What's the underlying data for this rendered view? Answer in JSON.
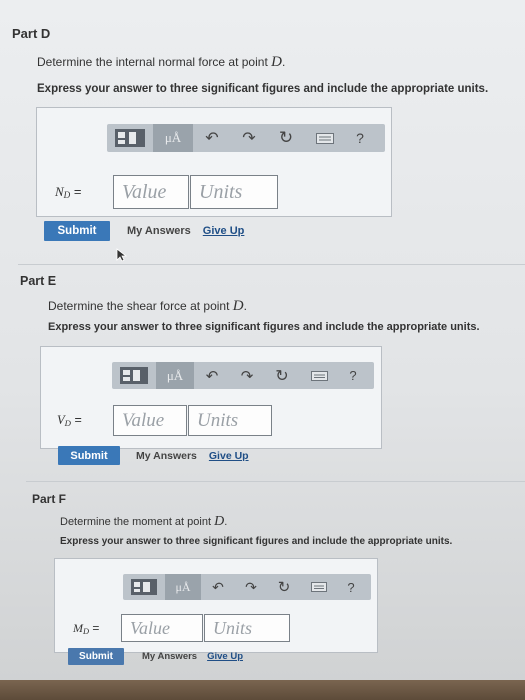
{
  "toolbar": {
    "mu_label": "μÅ",
    "undo_icon": "undo-arrow",
    "redo_icon": "redo-arrow",
    "reset_icon": "reset",
    "keyboard_icon": "keyboard",
    "help_label": "?"
  },
  "parts": [
    {
      "title": "Part D",
      "question_prefix": "Determine the internal normal force at point ",
      "question_var": "D",
      "question_suffix": ".",
      "instruction": "Express your answer to three significant figures and include the appropriate units.",
      "var_main": "N",
      "var_sub": "D",
      "equals": " =",
      "value_placeholder": "Value",
      "units_placeholder": "Units",
      "submit_label": "Submit",
      "my_answers_label": "My Answers",
      "give_up_label": "Give Up"
    },
    {
      "title": "Part E",
      "question_prefix": "Determine the shear force at point ",
      "question_var": "D",
      "question_suffix": ".",
      "instruction": "Express your answer to three significant figures and include the appropriate units.",
      "var_main": "V",
      "var_sub": "D",
      "equals": " =",
      "value_placeholder": "Value",
      "units_placeholder": "Units",
      "submit_label": "Submit",
      "my_answers_label": "My Answers",
      "give_up_label": "Give Up"
    },
    {
      "title": "Part F",
      "question_prefix": "Determine the moment at point ",
      "question_var": "D",
      "question_suffix": ".",
      "instruction": "Express your answer to three significant figures and include the appropriate units.",
      "var_main": "M",
      "var_sub": "D",
      "equals": " =",
      "value_placeholder": "Value",
      "units_placeholder": "Units",
      "submit_label": "Submit",
      "my_answers_label": "My Answers",
      "give_up_label": "Give Up"
    }
  ],
  "colors": {
    "submit_bg": "#3a78b8",
    "link": "#1f4e86",
    "toolbar_bg": "#bcc3ca"
  }
}
